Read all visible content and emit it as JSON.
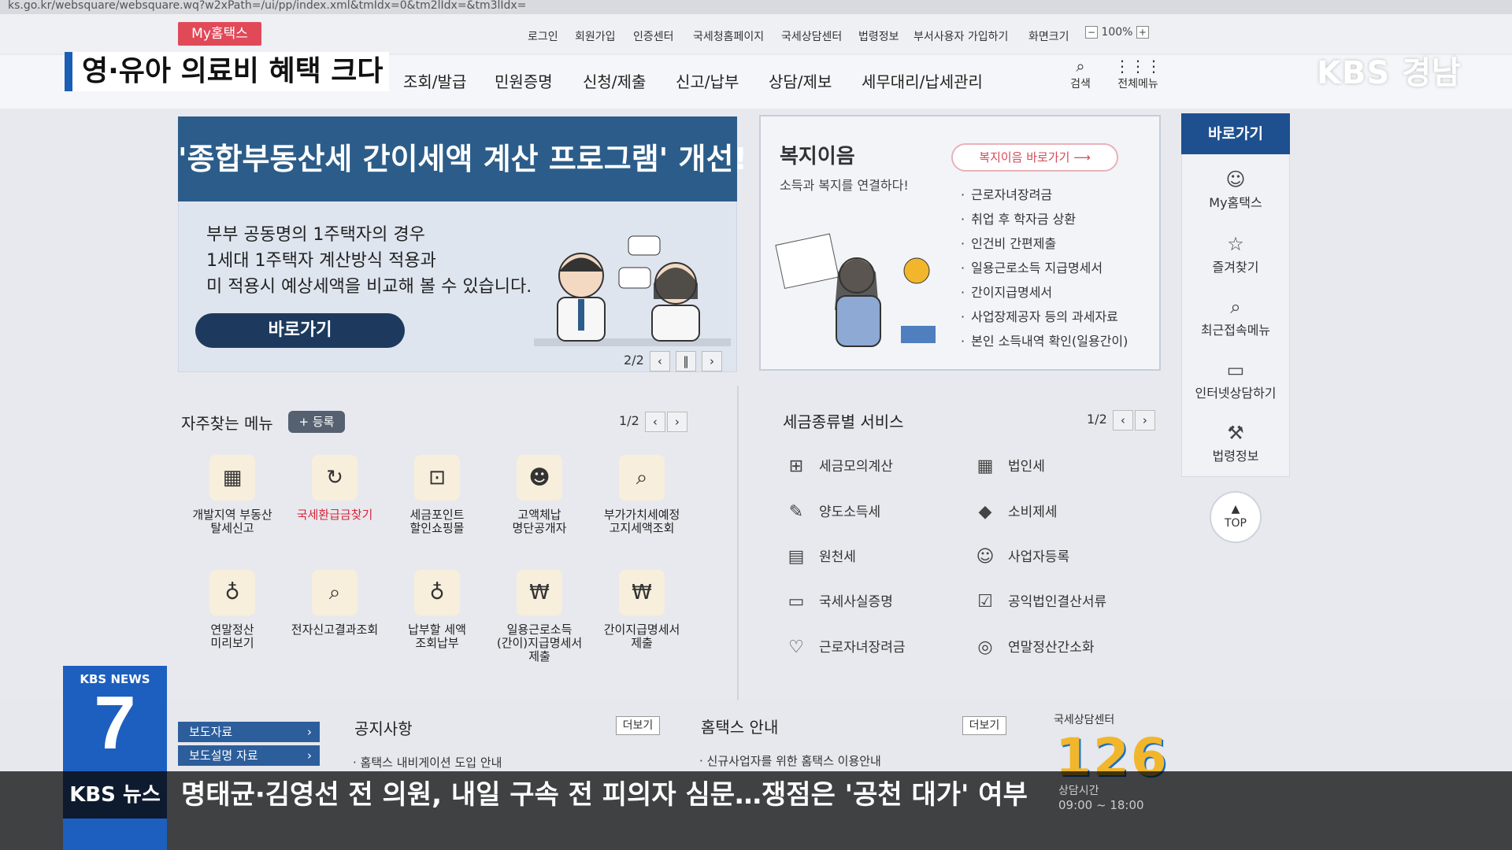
{
  "browser": {
    "url": "ks.go.kr/websquare/websquare.wq?w2xPath=/ui/pp/index.xml&tmIdx=0&tm2lIdx=&tm3lIdx="
  },
  "header": {
    "mytax_tag": "My홈택스",
    "util_links": [
      "로그인",
      "회원가입",
      "인증센터",
      "국세청홈페이지",
      "국세상담센터",
      "법령정보",
      "부서사용자 가입하기",
      "화면크기"
    ],
    "zoom": "100%",
    "gnb": [
      "조회/발급",
      "민원증명",
      "신청/제출",
      "신고/납부",
      "상담/제보",
      "세무대리/납세관리"
    ],
    "search_label": "검색",
    "allmenu_label": "전체메뉴"
  },
  "overlay": {
    "headline": "영·유아 의료비 혜택 크다",
    "station": "KBS 경남",
    "news_badge_top": "KBS NEWS",
    "news_badge_num": "7",
    "ticker_brand": "KBS 뉴스",
    "ticker_text": "명태균·김영선 전 의원, 내일 구속 전 피의자 심문…쟁점은 '공천 대가' 여부"
  },
  "banner": {
    "title": "'종합부동산세 간이세액 계산 프로그램' 개선!",
    "desc": [
      "부부 공동명의 1주택자의 경우",
      "1세대 1주택자 계산방식 적용과",
      "미 적용시 예상세액을 비교해 볼 수 있습니다."
    ],
    "button": "바로가기",
    "pager": "2/2"
  },
  "welfare": {
    "title": "복지이음",
    "subtitle": "소득과 복지를 연결하다!",
    "go_button": "복지이음 바로가기",
    "items": [
      "근로자녀장려금",
      "취업 후 학자금 상환",
      "인건비 간편제출",
      "일용근로소득 지급명세서",
      "간이지급명세서",
      "사업장제공자 등의 과세자료",
      "본인 소득내역 확인(일용간이)"
    ]
  },
  "quick_menu": {
    "title": "바로가기",
    "items": [
      {
        "label": "My홈택스",
        "icon": "person-icon"
      },
      {
        "label": "즐겨찾기",
        "icon": "star-icon"
      },
      {
        "label": "최근접속메뉴",
        "icon": "recent-icon"
      },
      {
        "label": "인터넷상담하기",
        "icon": "consult-icon"
      },
      {
        "label": "법령정보",
        "icon": "gavel-icon"
      }
    ],
    "top": "TOP"
  },
  "frequent_menu": {
    "title": "자주찾는 메뉴",
    "register": "+ 등록",
    "pager": "1/2",
    "items": [
      {
        "label": "개발지역 부동산\n탈세신고",
        "highlight": false
      },
      {
        "label": "국세환급금찾기",
        "highlight": true
      },
      {
        "label": "세금포인트\n할인쇼핑몰",
        "highlight": false
      },
      {
        "label": "고액체납\n명단공개자",
        "highlight": false
      },
      {
        "label": "부가가치세예정\n고지세액조회",
        "highlight": false
      },
      {
        "label": "연말정산\n미리보기",
        "highlight": false
      },
      {
        "label": "전자신고결과조회",
        "highlight": false
      },
      {
        "label": "납부할 세액\n조회납부",
        "highlight": false
      },
      {
        "label": "일용근로소득\n(간이)지급명세서\n제출",
        "highlight": false
      },
      {
        "label": "간이지급명세서\n제출",
        "highlight": false
      }
    ]
  },
  "tax_service": {
    "title": "세금종류별 서비스",
    "pager": "1/2",
    "left": [
      "세금모의계산",
      "양도소득세",
      "원천세",
      "국세사실증명",
      "근로자녀장려금"
    ],
    "right": [
      "법인세",
      "소비제세",
      "사업자등록",
      "공익법인결산서류",
      "연말정산간소화"
    ]
  },
  "bottom": {
    "press": [
      "보도자료",
      "보도설명 자료"
    ],
    "notice_title": "공지사항",
    "notice_more": "더보기",
    "notice_items": [
      "홈택스 내비게이션 도입 안내"
    ],
    "guide_title": "홈택스 안내",
    "guide_more": "더보기",
    "guide_items": [
      "신규사업자를 위한 홈택스 이용안내"
    ],
    "callcenter_title": "국세상담센터",
    "callcenter_number": "126",
    "hours_label": "상담시간",
    "hours": "09:00 ~ 18:00"
  }
}
